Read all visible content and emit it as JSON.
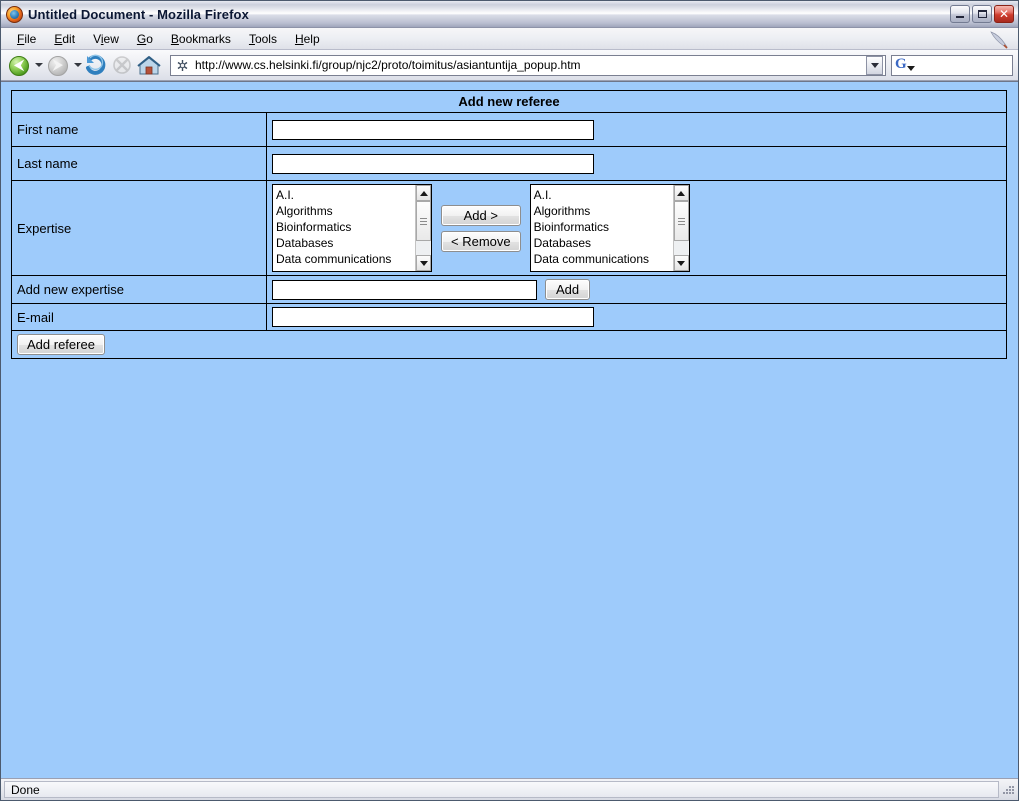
{
  "window": {
    "title": "Untitled Document - Mozilla Firefox",
    "logo_icon": "firefox-logo-icon",
    "minimize_label": "Minimize",
    "maximize_label": "Maximize",
    "close_label": "Close"
  },
  "menubar": {
    "items": [
      {
        "label": "File",
        "accesskey": "F"
      },
      {
        "label": "Edit",
        "accesskey": "E"
      },
      {
        "label": "View",
        "accesskey": "V"
      },
      {
        "label": "Go",
        "accesskey": "G"
      },
      {
        "label": "Bookmarks",
        "accesskey": "B"
      },
      {
        "label": "Tools",
        "accesskey": "T"
      },
      {
        "label": "Help",
        "accesskey": "H"
      }
    ],
    "throbber_icon": "firefox-throbber-icon"
  },
  "toolbar": {
    "back_icon": "back-arrow-icon",
    "forward_icon": "forward-arrow-icon",
    "reload_icon": "reload-icon",
    "stop_icon": "stop-icon",
    "home_icon": "home-icon",
    "url": "http://www.cs.helsinki.fi/group/njc2/proto/toimitus/asiantuntija_popup.htm",
    "url_placeholder": "",
    "site_icon": "page-favicon-icon",
    "url_dropdown_icon": "chevron-down-icon",
    "search_engine_icon": "google-g-icon",
    "search_value": "",
    "search_placeholder": ""
  },
  "page": {
    "background_color": "#9ecbfb",
    "form": {
      "header": "Add new referee",
      "rows": {
        "first_name": {
          "label": "First name",
          "value": "",
          "placeholder": ""
        },
        "last_name": {
          "label": "Last name",
          "value": "",
          "placeholder": ""
        },
        "expertise": {
          "label": "Expertise",
          "available_items": [
            "A.I.",
            "Algorithms",
            "Bioinformatics",
            "Databases",
            "Data communications"
          ],
          "selected_items": [
            "A.I.",
            "Algorithms",
            "Bioinformatics",
            "Databases",
            "Data communications"
          ],
          "add_button": "Add >",
          "remove_button": "< Remove"
        },
        "add_new_expertise": {
          "label": "Add new expertise",
          "value": "",
          "placeholder": "",
          "add_button": "Add"
        },
        "email": {
          "label": "E-mail",
          "value": "",
          "placeholder": ""
        }
      },
      "submit_button": "Add referee"
    }
  },
  "statusbar": {
    "text": "Done",
    "resize_grip_icon": "resize-grip-icon"
  },
  "colors": {
    "page_blue": "#9ecbfb",
    "header_gray": "#c9c9c9",
    "border_black": "#000000",
    "title_bar": "#ccd0dd"
  }
}
